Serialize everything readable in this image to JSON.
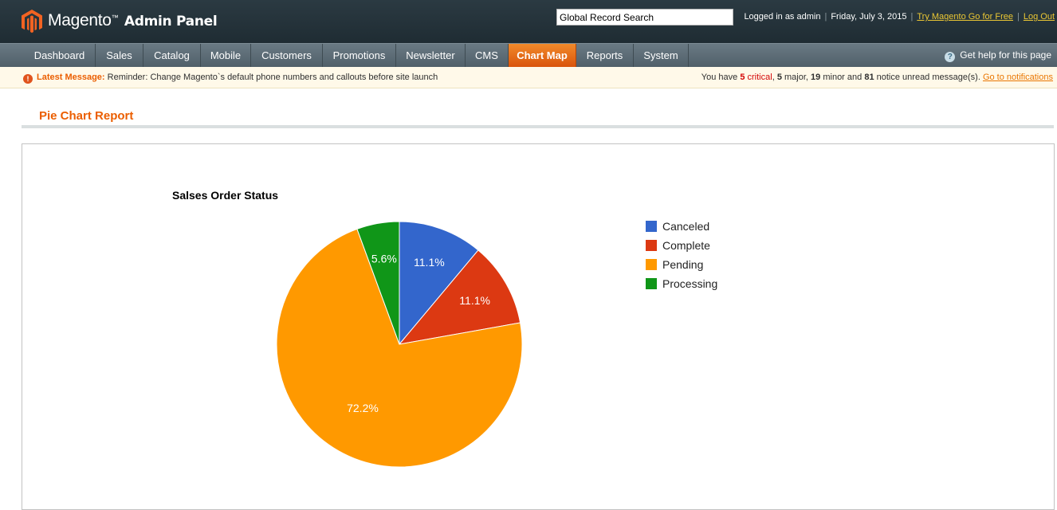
{
  "header": {
    "brand": "Magento",
    "trademark": "™",
    "product": "Admin Panel",
    "search_placeholder": "Global Record Search",
    "logged_in": "Logged in as admin",
    "date": "Friday, July 3, 2015",
    "try_link": "Try Magento Go for Free",
    "logout": "Log Out",
    "logo_icon": "magento-logo-icon"
  },
  "nav": {
    "items": [
      {
        "label": "Dashboard"
      },
      {
        "label": "Sales"
      },
      {
        "label": "Catalog"
      },
      {
        "label": "Mobile"
      },
      {
        "label": "Customers"
      },
      {
        "label": "Promotions"
      },
      {
        "label": "Newsletter"
      },
      {
        "label": "CMS"
      },
      {
        "label": "Chart Map",
        "active": true
      },
      {
        "label": "Reports"
      },
      {
        "label": "System"
      }
    ],
    "help": "Get help for this page"
  },
  "message": {
    "label": "Latest Message:",
    "text": "Reminder: Change Magento`s default phone numbers and callouts before site launch",
    "you_have": "You have",
    "critical_count": "5",
    "critical_word": "critical",
    "major_count": "5",
    "major_word": "major,",
    "minor_count": "19",
    "minor_word": "minor and",
    "notice_count": "81",
    "notice_word": "notice unread message(s).",
    "link": "Go to notifications"
  },
  "page": {
    "title": "Pie Chart Report"
  },
  "colors": {
    "accent": "#eb5e00",
    "header_bg": "#2b3a42",
    "nav_bg": "#5d6d77"
  },
  "chart_data": {
    "type": "pie",
    "title": "Salses Order Status",
    "labels": [
      "Canceled",
      "Complete",
      "Pending",
      "Processing"
    ],
    "values": [
      11.1,
      11.1,
      72.2,
      5.6
    ],
    "slice_labels": [
      "11.1%",
      "11.1%",
      "72.2%",
      "5.6%"
    ],
    "colors": [
      "#3366cc",
      "#dc3912",
      "#ff9900",
      "#109618"
    ],
    "legend_position": "right"
  }
}
